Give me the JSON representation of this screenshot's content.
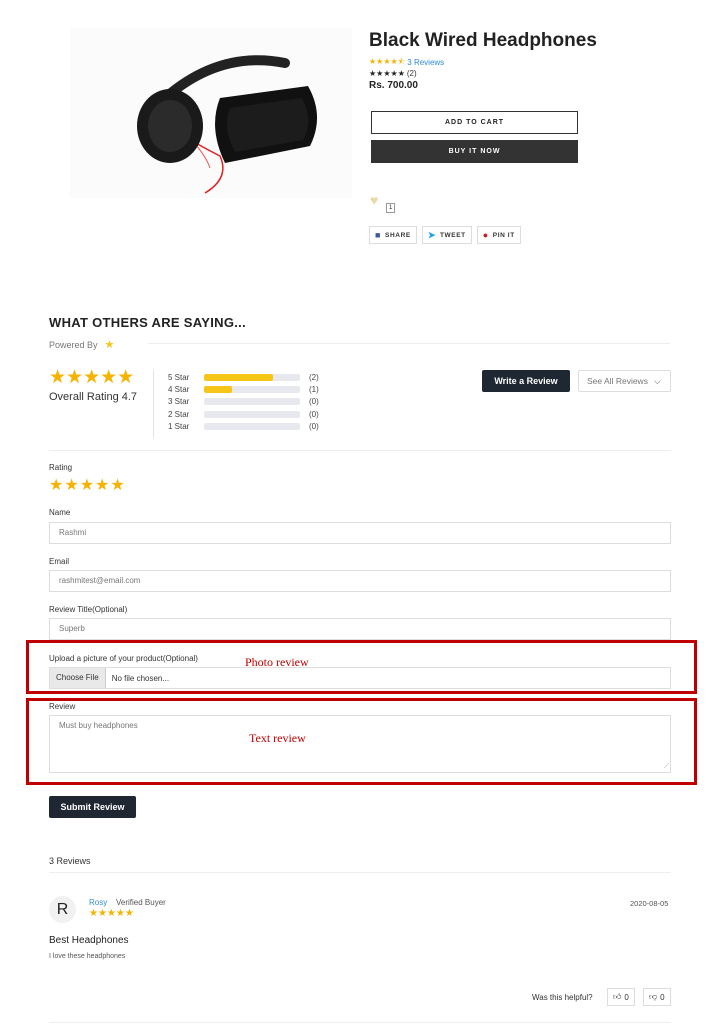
{
  "product": {
    "title": "Black Wired Headphones",
    "rating_stars": "★★★★⯪",
    "reviews_link": "3 Reviews",
    "rating_stars_2": "★★★★★",
    "rating_count_2": "(2)",
    "price": "Rs. 700.00",
    "add_to_cart": "ADD TO CART",
    "buy_now": "BUY IT NOW",
    "wishlist_count": "1",
    "share": "SHARE",
    "tweet": "TWEET",
    "pin": "PIN IT"
  },
  "reviews_widget": {
    "heading": "WHAT OTHERS ARE SAYING...",
    "powered_by": "Powered By",
    "overall_stars": "★★★★★",
    "overall_rating": "Overall Rating 4.7",
    "bars": [
      {
        "label": "5 Star",
        "fraction": 0.72,
        "count": "(2)"
      },
      {
        "label": "4 Star",
        "fraction": 0.29,
        "count": "(1)"
      },
      {
        "label": "3 Star",
        "fraction": 0,
        "count": "(0)"
      },
      {
        "label": "2 Star",
        "fraction": 0,
        "count": "(0)"
      },
      {
        "label": "1 Star",
        "fraction": 0,
        "count": "(0)"
      }
    ],
    "write_review": "Write a Review",
    "see_all": "See All Reviews"
  },
  "form": {
    "rating_label": "Rating",
    "rating_stars": "★★★★★",
    "name_label": "Name",
    "name_value": "Rashmi",
    "email_label": "Email",
    "email_value": "rashmitest@email.com",
    "title_label": "Review Title(Optional)",
    "title_value": "Superb",
    "upload_label": "Upload a picture of your product(Optional)",
    "choose_file": "Choose File",
    "no_file": "No file chosen...",
    "review_label": "Review",
    "review_value": "Must buy headphones",
    "submit": "Submit Review"
  },
  "annotations": {
    "photo": "Photo review",
    "text": "Text review",
    "color": "#c00000"
  },
  "review_list": {
    "count_heading": "3 Reviews",
    "items": [
      {
        "avatar": "R",
        "author": "Rosy",
        "badge": "Verified Buyer",
        "stars": "★★★★★",
        "date": "2020-08-05",
        "title": "Best Headphones",
        "body": "I love these headphones",
        "helpful_label": "Was this helpful?",
        "up": "0",
        "down": "0"
      }
    ]
  },
  "colors": {
    "accent_star": "#f5b300",
    "dark_button": "#1f2733",
    "link": "#2e8bd6"
  }
}
